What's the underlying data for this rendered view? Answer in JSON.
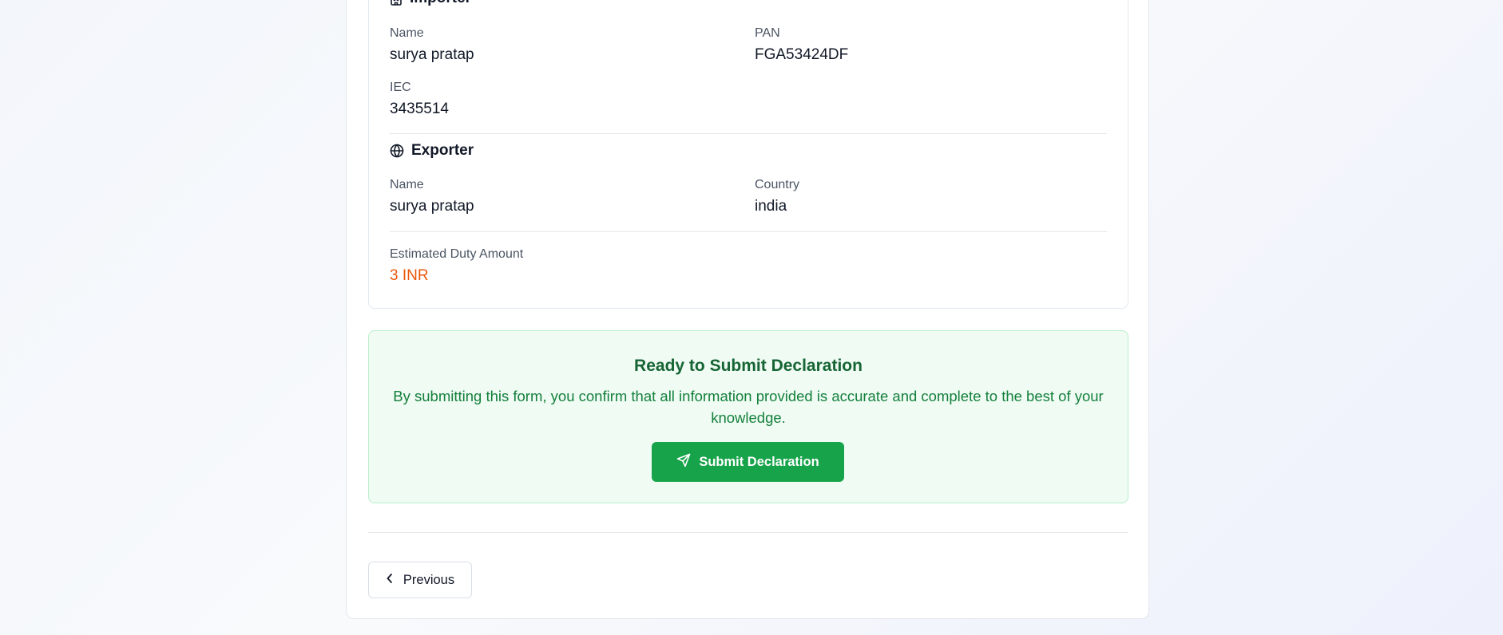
{
  "importer": {
    "title": "Importer",
    "icon": "building-icon",
    "name_label": "Name",
    "name_value": "surya pratap",
    "pan_label": "PAN",
    "pan_value": "FGA53424DF",
    "iec_label": "IEC",
    "iec_value": "3435514"
  },
  "exporter": {
    "title": "Exporter",
    "icon": "globe-icon",
    "name_label": "Name",
    "name_value": "surya pratap",
    "country_label": "Country",
    "country_value": "india"
  },
  "duty": {
    "label": "Estimated Duty Amount",
    "value": "3 INR"
  },
  "ready": {
    "title": "Ready to Submit Declaration",
    "description": "By submitting this form, you confirm that all information provided is accurate and complete to the best of your knowledge.",
    "submit_label": "Submit Declaration",
    "submit_icon": "send-icon"
  },
  "nav": {
    "previous_label": "Previous",
    "previous_icon": "chevron-left-icon"
  },
  "colors": {
    "accent_orange": "#ea580c",
    "success_green": "#16a34a",
    "success_bg": "#effbf3",
    "success_text": "#15803d",
    "success_title": "#166534"
  }
}
